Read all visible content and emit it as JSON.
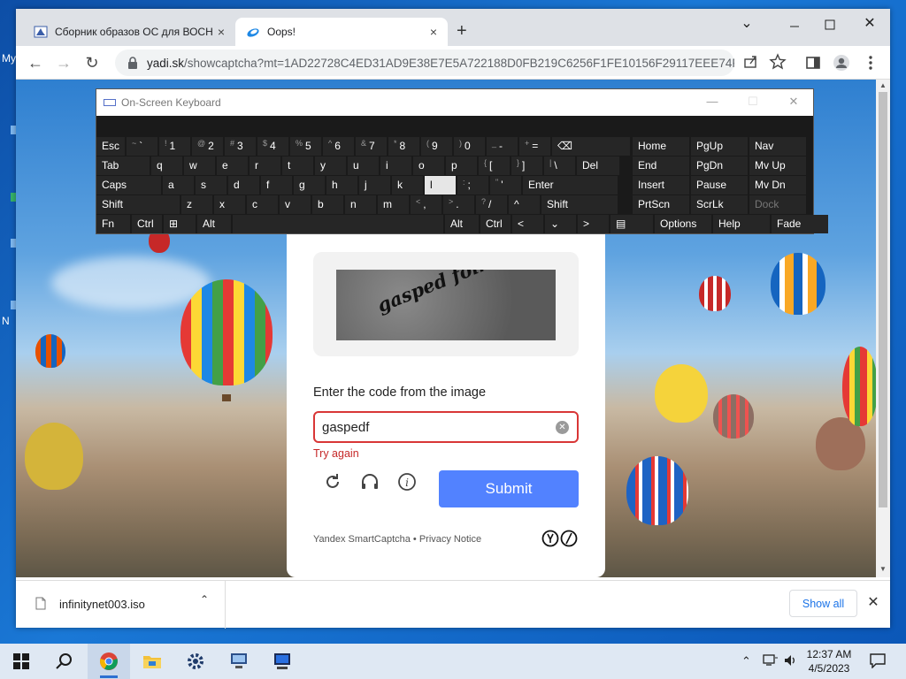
{
  "desktop": {
    "labels": [
      "My",
      "N"
    ]
  },
  "browser": {
    "tabs": [
      {
        "title": "Сборник образов ОС для ВОСН",
        "close": "×"
      },
      {
        "title": "Oops!",
        "close": "×"
      }
    ],
    "new_tab": "+",
    "window_controls": {
      "minimize": "⌄",
      "maximize": "☐",
      "close": "✕"
    },
    "nav": {
      "back": "←",
      "forward": "→",
      "reload": "↻"
    },
    "url": {
      "host": "yadi.sk",
      "path": "/showcaptcha?mt=1AD22728C4ED31AD9E38E7E5A722188D0FB219C6256F1FE10156F29117EEE74F..."
    }
  },
  "captcha": {
    "image_text": "gasped folk",
    "prompt": "Enter the code from the image",
    "input_value": "gaspedf",
    "clear_icon": "✕",
    "error": "Try again",
    "submit_label": "Submit",
    "footer": "Yandex SmartCaptcha • Privacy Notice"
  },
  "downloads": {
    "file_name": "infinitynet003.iso",
    "chevron": "⌃",
    "show_all": "Show all",
    "close": "✕"
  },
  "osk": {
    "title": "On-Screen Keyboard",
    "controls": {
      "minimize": "—",
      "maximize": "☐",
      "close": "✕"
    },
    "rows": [
      [
        {
          "l": "Esc"
        },
        {
          "s": "~",
          "l": "`"
        },
        {
          "s": "!",
          "l": "1"
        },
        {
          "s": "@",
          "l": "2"
        },
        {
          "s": "#",
          "l": "3"
        },
        {
          "s": "$",
          "l": "4"
        },
        {
          "s": "%",
          "l": "5"
        },
        {
          "s": "^",
          "l": "6"
        },
        {
          "s": "&",
          "l": "7"
        },
        {
          "s": "*",
          "l": "8"
        },
        {
          "s": "(",
          "l": "9"
        },
        {
          "s": ")",
          "l": "0"
        },
        {
          "s": "_",
          "l": "-"
        },
        {
          "s": "+",
          "l": "="
        },
        {
          "l": "⌫"
        },
        {
          "l": "Home"
        },
        {
          "l": "PgUp"
        },
        {
          "l": "Nav"
        }
      ],
      [
        {
          "l": "Tab"
        },
        {
          "l": "q"
        },
        {
          "l": "w"
        },
        {
          "l": "e"
        },
        {
          "l": "r"
        },
        {
          "l": "t"
        },
        {
          "l": "y"
        },
        {
          "l": "u"
        },
        {
          "l": "i"
        },
        {
          "l": "o"
        },
        {
          "l": "p"
        },
        {
          "s": "{",
          "l": "["
        },
        {
          "s": "}",
          "l": "]"
        },
        {
          "s": "|",
          "l": "\\"
        },
        {
          "l": "Del"
        },
        {
          "l": "End"
        },
        {
          "l": "PgDn"
        },
        {
          "l": "Mv Up"
        }
      ],
      [
        {
          "l": "Caps"
        },
        {
          "l": "a"
        },
        {
          "l": "s"
        },
        {
          "l": "d"
        },
        {
          "l": "f"
        },
        {
          "l": "g"
        },
        {
          "l": "h"
        },
        {
          "l": "j"
        },
        {
          "l": "k"
        },
        {
          "l": "l"
        },
        {
          "s": ":",
          "l": ";"
        },
        {
          "s": "\"",
          "l": "'"
        },
        {
          "l": "Enter"
        },
        {
          "l": "Insert"
        },
        {
          "l": "Pause"
        },
        {
          "l": "Mv Dn"
        }
      ],
      [
        {
          "l": "Shift"
        },
        {
          "l": "z"
        },
        {
          "l": "x"
        },
        {
          "l": "c"
        },
        {
          "l": "v"
        },
        {
          "l": "b"
        },
        {
          "l": "n"
        },
        {
          "l": "m"
        },
        {
          "s": "<",
          "l": ","
        },
        {
          "s": ">",
          "l": "."
        },
        {
          "s": "?",
          "l": "/"
        },
        {
          "l": "^"
        },
        {
          "l": "Shift"
        },
        {
          "l": "PrtScn"
        },
        {
          "l": "ScrLk"
        },
        {
          "l": "Dock"
        }
      ],
      [
        {
          "l": "Fn"
        },
        {
          "l": "Ctrl"
        },
        {
          "l": "⊞"
        },
        {
          "l": "Alt"
        },
        {
          "l": ""
        },
        {
          "l": "Alt"
        },
        {
          "l": "Ctrl"
        },
        {
          "l": "<"
        },
        {
          "l": "⌄"
        },
        {
          "l": ">"
        },
        {
          "l": "▤"
        },
        {
          "l": "Options"
        },
        {
          "l": "Help"
        },
        {
          "l": "Fade"
        }
      ]
    ],
    "highlighted_key": "l",
    "dim_key": "Dock"
  },
  "taskbar": {
    "search_icon": "⚲",
    "tray_chevron": "⌃",
    "volume": "🔊",
    "time": "12:37 AM",
    "date": "4/5/2023"
  },
  "colors": {
    "submit": "#5282ff",
    "error": "#c62828",
    "osk_bg": "#1a1a1a"
  }
}
